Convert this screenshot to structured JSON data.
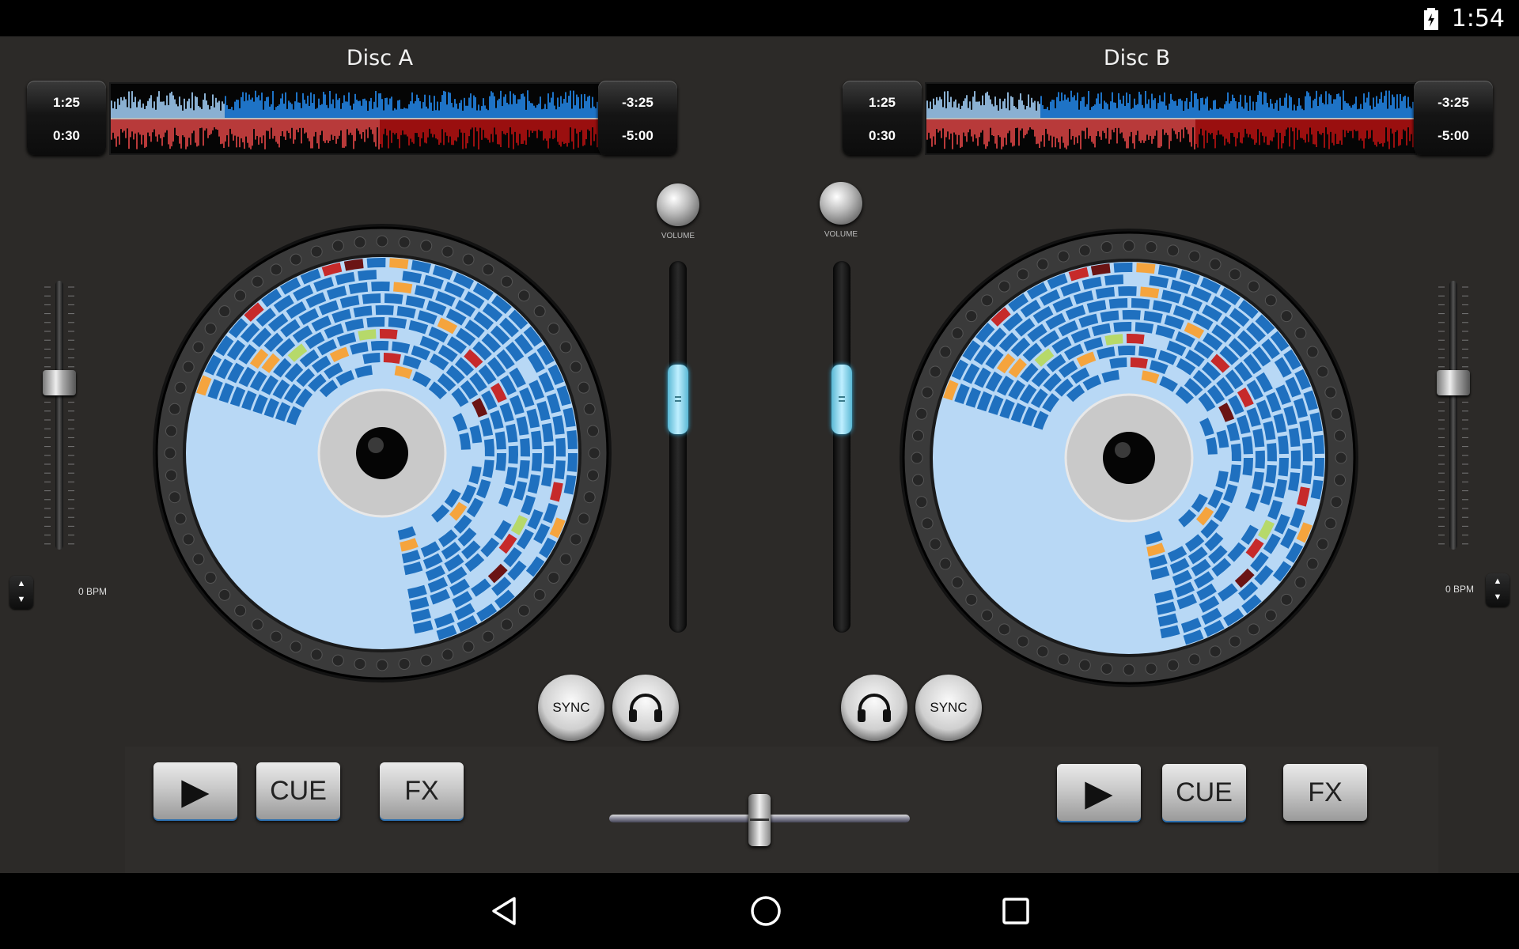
{
  "status_bar": {
    "time": "1:54"
  },
  "decks": {
    "a": {
      "title": "Disc A",
      "elapsed_time": "1:25",
      "cue_time": "0:30",
      "remaining_time": "-3:25",
      "total_time": "-5:00",
      "bpm": "0 BPM",
      "play_label": "▶",
      "cue_label": "CUE",
      "fx_label": "FX",
      "sync_label": "SYNC",
      "volume_label": "VOLUME",
      "pitch_up": "▲",
      "pitch_down": "▼"
    },
    "b": {
      "title": "Disc B",
      "elapsed_time": "1:25",
      "cue_time": "0:30",
      "remaining_time": "-3:25",
      "total_time": "-5:00",
      "bpm": "0 BPM",
      "play_label": "▶",
      "cue_label": "CUE",
      "fx_label": "FX",
      "sync_label": "SYNC",
      "volume_label": "VOLUME",
      "pitch_up": "▲",
      "pitch_down": "▼"
    }
  },
  "levels": {
    "volume_a": 0.5,
    "volume_b": 0.5,
    "pitch_a": 0.38,
    "pitch_b": 0.38,
    "crossfader": 0.5,
    "waveform_progress": 0.23,
    "waveform_cue_progress": 0.55
  },
  "colors": {
    "platter_bg": "#b8d8f5",
    "tile_blue": "#1f70bf",
    "tile_green": "#b6d96a",
    "tile_orange": "#f5a43d",
    "tile_red": "#c62a2a",
    "tile_maroon": "#6b1414",
    "accent": "#2a6fb0"
  },
  "icons": {
    "headphones": "headphones-icon",
    "back": "back-icon",
    "home": "home-icon",
    "recents": "recents-icon",
    "battery": "battery-icon"
  }
}
